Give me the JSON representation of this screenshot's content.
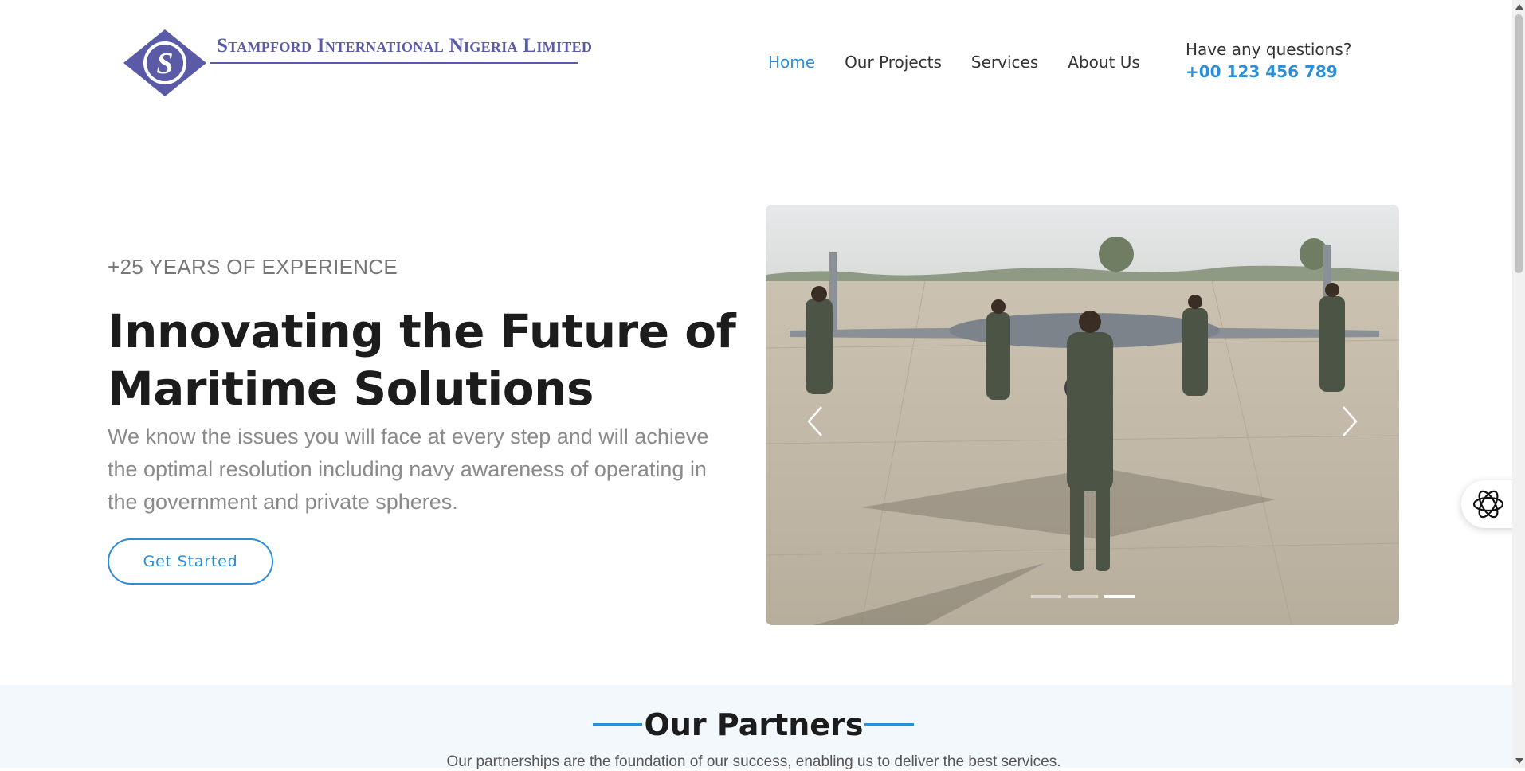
{
  "brand": {
    "name": "Stampford International Nigeria Limited",
    "logo_letter": "S"
  },
  "nav": [
    {
      "label": "Home",
      "active": true
    },
    {
      "label": "Our Projects",
      "active": false
    },
    {
      "label": "Services",
      "active": false
    },
    {
      "label": "About Us",
      "active": false
    }
  ],
  "contact": {
    "question": "Have any questions?",
    "phone": "+00 123 456 789"
  },
  "hero": {
    "eyebrow": "+25 YEARS OF EXPERIENCE",
    "title_line1": "Innovating the Future of",
    "title_line2": "Maritime Solutions",
    "description": "We know the issues you will face at every step and will achieve the optimal resolution including navy awareness of operating in the government and private spheres.",
    "cta_label": "Get Started"
  },
  "carousel": {
    "slide_count": 3,
    "active_slide": 3,
    "prev_icon": "chevron-left-icon",
    "next_icon": "chevron-right-icon"
  },
  "widget": {
    "icon": "ai-assistant-icon"
  },
  "partners": {
    "title": "Our Partners",
    "subtitle": "Our partnerships are the foundation of our success, enabling us to deliver the best services."
  },
  "colors": {
    "accent": "#2a8fd6",
    "brand": "#5a5aa6",
    "partners_bg": "#f3f8fc"
  }
}
